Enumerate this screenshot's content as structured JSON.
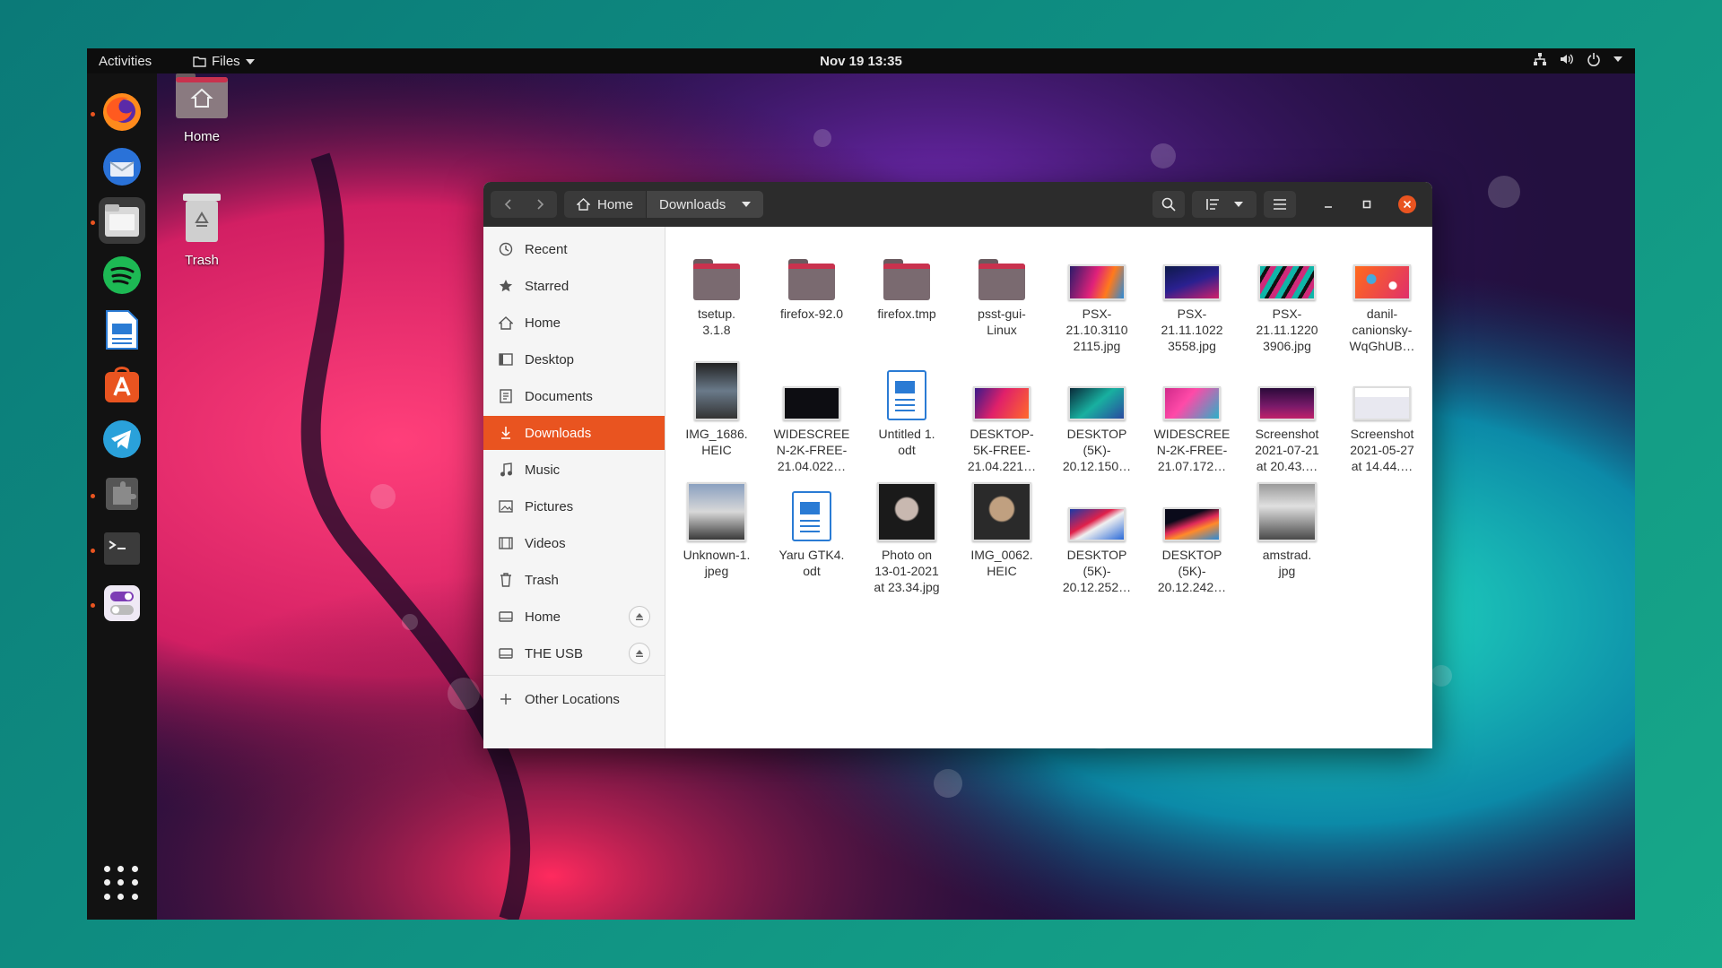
{
  "topbar": {
    "activities": "Activities",
    "app_menu": "Files",
    "clock": "Nov 19  13:35"
  },
  "desktop": {
    "icons": [
      {
        "label": "Home"
      },
      {
        "label": "Trash"
      }
    ]
  },
  "dock": {
    "apps": [
      "firefox",
      "thunderbird",
      "files",
      "spotify",
      "libreoffice-writer",
      "software-center",
      "telegram",
      "extensions",
      "terminal",
      "settings-toggle"
    ],
    "running": [
      "firefox",
      "files",
      "extensions",
      "terminal",
      "settings-toggle"
    ]
  },
  "window": {
    "breadcrumbs": [
      "Home",
      "Downloads"
    ],
    "sidebar": [
      {
        "label": "Recent",
        "icon": "clock-icon"
      },
      {
        "label": "Starred",
        "icon": "star-icon"
      },
      {
        "label": "Home",
        "icon": "home-icon"
      },
      {
        "label": "Desktop",
        "icon": "desktop-icon"
      },
      {
        "label": "Documents",
        "icon": "documents-icon"
      },
      {
        "label": "Downloads",
        "icon": "download-icon",
        "selected": true
      },
      {
        "label": "Music",
        "icon": "music-icon"
      },
      {
        "label": "Pictures",
        "icon": "pictures-icon"
      },
      {
        "label": "Videos",
        "icon": "videos-icon"
      },
      {
        "label": "Trash",
        "icon": "trash-icon"
      },
      {
        "label": "Home",
        "icon": "drive-icon",
        "eject": true
      },
      {
        "label": "THE USB",
        "icon": "drive-icon",
        "eject": true
      },
      {
        "label": "Other Locations",
        "icon": "plus-icon"
      }
    ],
    "files": [
      {
        "name": "tsetup.\n3.1.8",
        "type": "folder"
      },
      {
        "name": "firefox-92.0",
        "type": "folder"
      },
      {
        "name": "firefox.tmp",
        "type": "folder"
      },
      {
        "name": "psst-gui-\nLinux",
        "type": "folder"
      },
      {
        "name": "PSX-\n21.10.3110\n2115.jpg",
        "type": "image"
      },
      {
        "name": "PSX-\n21.11.1022\n3558.jpg",
        "type": "image"
      },
      {
        "name": "PSX-\n21.11.1220\n3906.jpg",
        "type": "image"
      },
      {
        "name": "danil-\ncanionsky-\nWqGhUB…",
        "type": "image"
      },
      {
        "name": "IMG_1686.\nHEIC",
        "type": "image"
      },
      {
        "name": "WIDESCREE\nN-2K-FREE-\n21.04.022…",
        "type": "image"
      },
      {
        "name": "Untitled 1.\nodt",
        "type": "document"
      },
      {
        "name": "DESKTOP-\n5K-FREE-\n21.04.221…",
        "type": "image"
      },
      {
        "name": "DESKTOP\n(5K)-\n20.12.150…",
        "type": "image"
      },
      {
        "name": "WIDESCREE\nN-2K-FREE-\n21.07.172…",
        "type": "image"
      },
      {
        "name": "Screenshot\n2021-07-21\nat 20.43.…",
        "type": "image"
      },
      {
        "name": "Screenshot\n2021-05-27\nat 14.44.…",
        "type": "image"
      },
      {
        "name": "Unknown-1.\njpeg",
        "type": "image"
      },
      {
        "name": "Yaru GTK4.\nodt",
        "type": "document"
      },
      {
        "name": "Photo on\n13-01-2021\nat 23.34.jpg",
        "type": "image"
      },
      {
        "name": "IMG_0062.\nHEIC",
        "type": "image"
      },
      {
        "name": "DESKTOP\n(5K)-\n20.12.252…",
        "type": "image"
      },
      {
        "name": "DESKTOP\n(5K)-\n20.12.242…",
        "type": "image"
      },
      {
        "name": "amstrad.\njpg",
        "type": "image"
      }
    ]
  },
  "colors": {
    "accent": "#e95420",
    "headerbar": "#2c2c2c",
    "topbar": "#0d0d0d"
  }
}
